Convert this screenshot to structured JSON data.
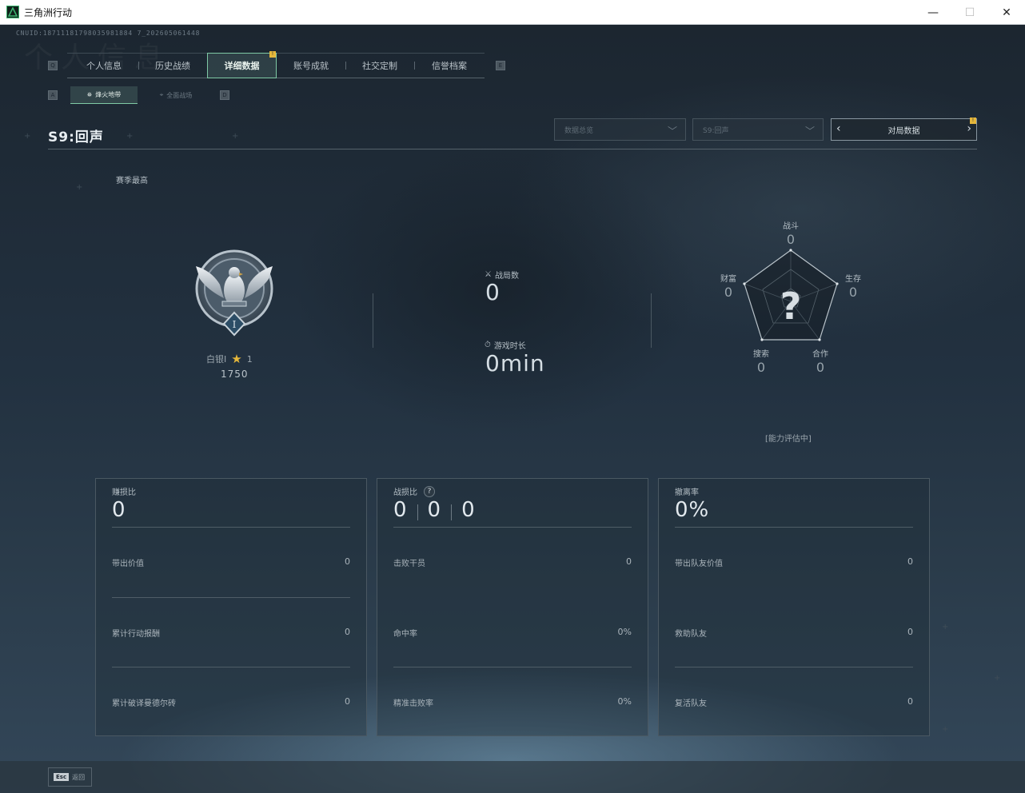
{
  "window": {
    "title": "三角洲行动",
    "controls": {
      "minimize": "—",
      "maximize": "☐",
      "close": "✕"
    }
  },
  "uid": "CNUID:18711181798035981884 7_202605061448",
  "bg_word": "个人信息",
  "tabs": {
    "left_key": "Q",
    "right_key": "E",
    "items": [
      {
        "label": "个人信息",
        "active": false
      },
      {
        "label": "历史战绩",
        "active": false
      },
      {
        "label": "详细数据",
        "active": true,
        "badge": "!"
      },
      {
        "label": "账号成就",
        "active": false
      },
      {
        "label": "社交定制",
        "active": false
      },
      {
        "label": "信誉档案",
        "active": false
      }
    ]
  },
  "subtabs": {
    "left_key": "A",
    "right_key": "D",
    "items": [
      {
        "label": "烽火地带",
        "active": true
      },
      {
        "label": "全面战场",
        "active": false
      }
    ]
  },
  "season": {
    "title": "S9:回声"
  },
  "filters": {
    "data_scope": "数据总览",
    "season_select": "S9:回声",
    "match_data_button": "对局数据",
    "match_badge": "!"
  },
  "season_best_label": "赛季最高",
  "rank": {
    "name": "白银I",
    "stars": "1",
    "score": "1750",
    "emblem_numeral": "I"
  },
  "overview": {
    "matches_label": "战局数",
    "matches_value": "0",
    "playtime_label": "游戏时长",
    "playtime_value": "0min"
  },
  "radar": {
    "center_mark": "?",
    "axes": [
      {
        "label": "战斗",
        "value": "0"
      },
      {
        "label": "生存",
        "value": "0"
      },
      {
        "label": "合作",
        "value": "0"
      },
      {
        "label": "搜索",
        "value": "0"
      },
      {
        "label": "财富",
        "value": "0"
      }
    ],
    "status": "[能力评估中]"
  },
  "panels": [
    {
      "title": "赚损比",
      "main": [
        "0"
      ],
      "rows": [
        {
          "label": "带出价值",
          "value": "0"
        },
        {
          "label": "累计行动报酬",
          "value": "0"
        },
        {
          "label": "累计破译曼德尔砖",
          "value": "0"
        }
      ]
    },
    {
      "title": "战损比",
      "help": "?",
      "main": [
        "0",
        "0",
        "0"
      ],
      "rows": [
        {
          "label": "击败干员",
          "value": "0"
        },
        {
          "label": "命中率",
          "value": "0%"
        },
        {
          "label": "精准击败率",
          "value": "0%"
        }
      ]
    },
    {
      "title": "撤离率",
      "main": [
        "0%"
      ],
      "rows": [
        {
          "label": "带出队友价值",
          "value": "0"
        },
        {
          "label": "救助队友",
          "value": "0"
        },
        {
          "label": "复活队友",
          "value": "0"
        }
      ]
    }
  ],
  "footer": {
    "esc_key": "Esc",
    "back_label": "返回"
  },
  "colors": {
    "accent": "#7fc9a5",
    "badge": "#e5b73b",
    "background": "#1b2530"
  }
}
